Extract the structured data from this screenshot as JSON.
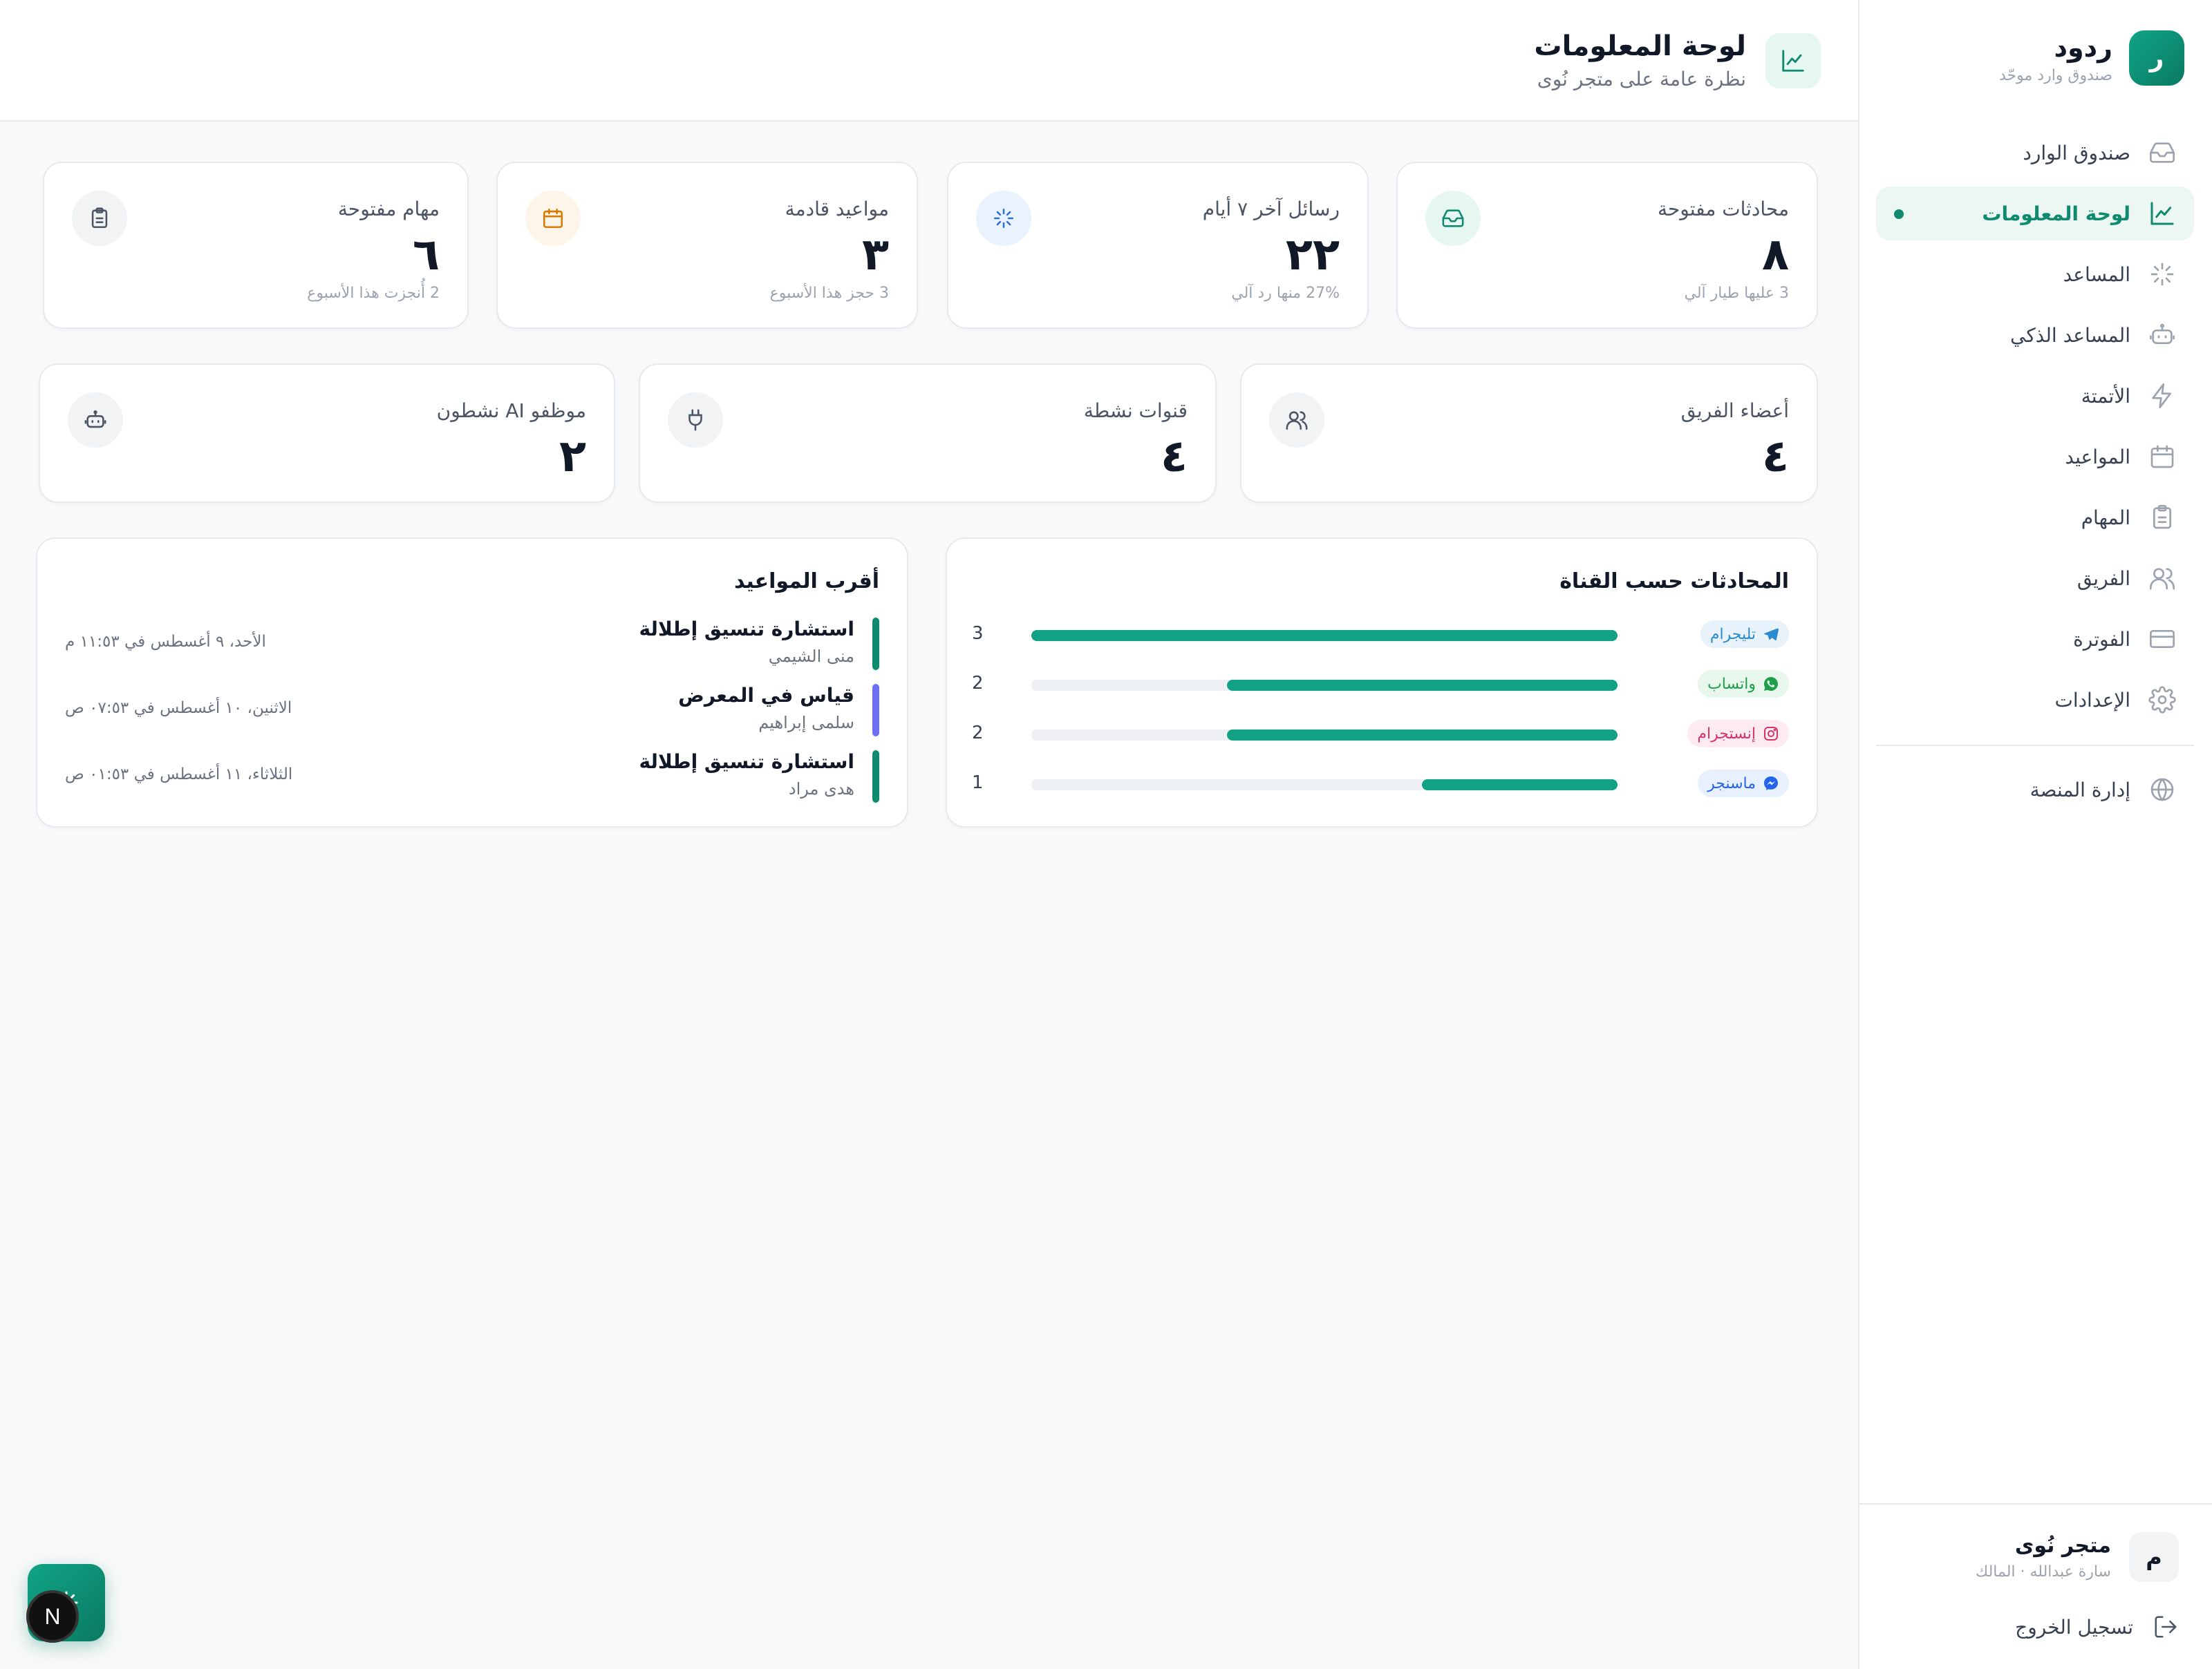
{
  "brand": {
    "logo_letter": "ر",
    "name": "ردود",
    "subtitle": "صندوق وارد موحّد"
  },
  "nav": {
    "items": [
      {
        "label": "صندوق الوارد",
        "icon": "inbox-icon",
        "active": false
      },
      {
        "label": "لوحة المعلومات",
        "icon": "chart-line-icon",
        "active": true
      },
      {
        "label": "المساعد",
        "icon": "sparkle-icon",
        "active": false
      },
      {
        "label": "المساعد الذكي",
        "icon": "bot-icon",
        "active": false
      },
      {
        "label": "الأتمتة",
        "icon": "lightning-icon",
        "active": false
      },
      {
        "label": "المواعيد",
        "icon": "calendar-icon",
        "active": false
      },
      {
        "label": "المهام",
        "icon": "clipboard-icon",
        "active": false
      },
      {
        "label": "الفريق",
        "icon": "users-icon",
        "active": false
      },
      {
        "label": "الفوترة",
        "icon": "credit-card-icon",
        "active": false
      },
      {
        "label": "الإعدادات",
        "icon": "gear-icon",
        "active": false
      }
    ],
    "admin": {
      "label": "إدارة المنصة",
      "icon": "globe-icon"
    }
  },
  "account": {
    "avatar_letter": "م",
    "name": "متجر نُوى",
    "subtitle": "سارة عبدالله · المالك",
    "logout_label": "تسجيل الخروج"
  },
  "header": {
    "title": "لوحة المعلومات",
    "subtitle": "نظرة عامة على متجر نُوى"
  },
  "stats_row1": [
    {
      "label": "محادثات مفتوحة",
      "value": "٨",
      "note": "3 عليها طيار آلي",
      "icon": "inbox-icon",
      "icon_bg": "#e6f6f1",
      "icon_color": "#0f8a6e"
    },
    {
      "label": "رسائل آخر ٧ أيام",
      "value": "٢٢",
      "note": "27% منها رد آلي",
      "icon": "sparkle-icon",
      "icon_bg": "#eaf3fd",
      "icon_color": "#2f6fd6"
    },
    {
      "label": "مواعيد قادمة",
      "value": "٣",
      "note": "3 حجز هذا الأسبوع",
      "icon": "calendar-icon",
      "icon_bg": "#fdf5e7",
      "icon_color": "#d97a06"
    },
    {
      "label": "مهام مفتوحة",
      "value": "٦",
      "note": "2 أُنجزت هذا الأسبوع",
      "icon": "clipboard-icon",
      "icon_bg": "#f1f3f5",
      "icon_color": "#4b5563"
    }
  ],
  "stats_row2": [
    {
      "label": "أعضاء الفريق",
      "value": "٤",
      "icon": "users-icon",
      "icon_bg": "#f1f3f5",
      "icon_color": "#4b5563"
    },
    {
      "label": "قنوات نشطة",
      "value": "٤",
      "icon": "plug-icon",
      "icon_bg": "#f1f3f5",
      "icon_color": "#4b5563"
    },
    {
      "label": "موظفو AI نشطون",
      "value": "٢",
      "icon": "bot-icon",
      "icon_bg": "#f1f3f5",
      "icon_color": "#4b5563"
    }
  ],
  "channels_panel": {
    "title": "المحادثات حسب القناة",
    "max": 3,
    "rows": [
      {
        "label": "تليجرام",
        "count": 3,
        "icon": "telegram-icon",
        "badge_bg": "#e8f2fb",
        "badge_color": "#2a8bd0"
      },
      {
        "label": "واتساب",
        "count": 2,
        "icon": "whatsapp-icon",
        "badge_bg": "#e7f7ec",
        "badge_color": "#1e9e4a"
      },
      {
        "label": "إنستجرام",
        "count": 2,
        "icon": "instagram-icon",
        "badge_bg": "#fdebf1",
        "badge_color": "#d6336c"
      },
      {
        "label": "ماسنجر",
        "count": 1,
        "icon": "messenger-icon",
        "badge_bg": "#e8f0fd",
        "badge_color": "#2563eb"
      }
    ]
  },
  "appointments_panel": {
    "title": "أقرب المواعيد",
    "items": [
      {
        "title": "استشارة تنسيق إطلالة",
        "person": "منى الشيمي",
        "time": "الأحد، ٩ أغسطس في ١١:٥٣ م",
        "color": "#0f8a6e"
      },
      {
        "title": "قياس في المعرض",
        "person": "سلمى إبراهيم",
        "time": "الاثنين، ١٠ أغسطس في ٠٧:٥٣ ص",
        "color": "#6b6ff0"
      },
      {
        "title": "استشارة تنسيق إطلالة",
        "person": "هدى مراد",
        "time": "الثلاثاء، ١١ أغسطس في ٠١:٥٣ ص",
        "color": "#0f8a6e"
      }
    ]
  },
  "dev_badge": {
    "letter": "N"
  }
}
